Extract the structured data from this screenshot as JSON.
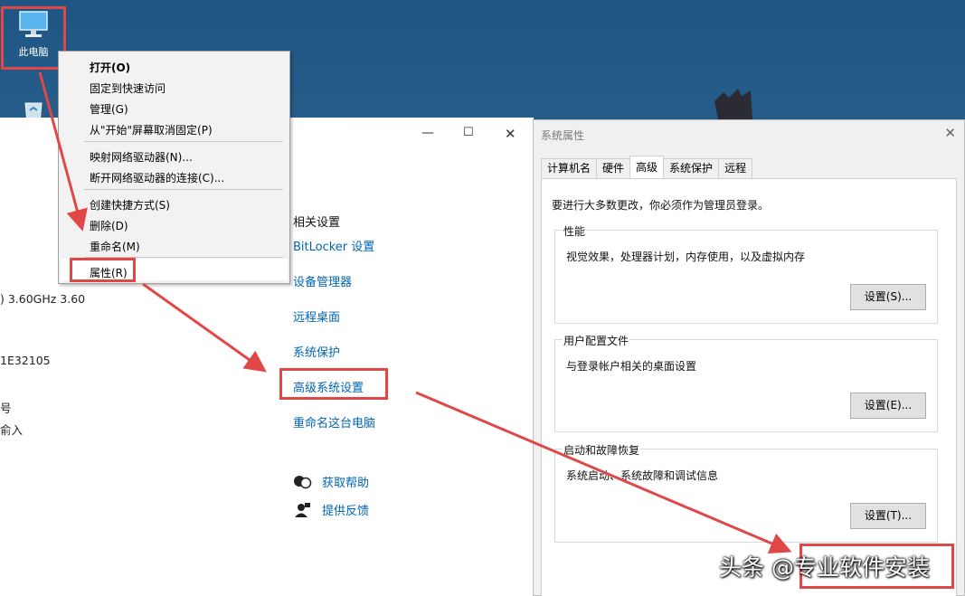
{
  "desktop": {
    "pc_icon_label": "此电脑",
    "icon_names": [
      "monitor-icon",
      "recycle-bin-icon"
    ]
  },
  "context_menu": {
    "items": [
      {
        "label": "打开(O)",
        "bold": true
      },
      {
        "label": "固定到快速访问"
      },
      {
        "label": "管理(G)"
      },
      {
        "label": "从\"开始\"屏幕取消固定(P)"
      },
      {
        "label": "映射网络驱动器(N)..."
      },
      {
        "label": "断开网络驱动器的连接(C)..."
      },
      {
        "label": "创建快捷方式(S)"
      },
      {
        "label": "删除(D)"
      },
      {
        "label": "重命名(M)"
      },
      {
        "label": "属性(R)"
      }
    ]
  },
  "system_window": {
    "controls": {
      "minimize": "—",
      "maximize": "☐",
      "close": "✕"
    },
    "left_fragments": [
      ") 3.60GHz   3.60",
      "1E32105",
      "号",
      "俞入"
    ],
    "related_title": "相关设置",
    "links": [
      "BitLocker 设置",
      "设备管理器",
      "远程桌面",
      "系统保护",
      "高级系统设置",
      "重命名这台电脑"
    ],
    "help": {
      "get_help": "获取帮助",
      "feedback": "提供反馈"
    }
  },
  "properties_dialog": {
    "title": "系统属性",
    "close": "✕",
    "tabs": [
      "计算机名",
      "硬件",
      "高级",
      "系统保护",
      "远程"
    ],
    "active_tab": "高级",
    "admin_note": "要进行大多数更改，你必须作为管理员登录。",
    "groups": [
      {
        "title": "性能",
        "desc": "视觉效果，处理器计划，内存使用，以及虚拟内存",
        "button": "设置(S)..."
      },
      {
        "title": "用户配置文件",
        "desc": "与登录帐户相关的桌面设置",
        "button": "设置(E)..."
      },
      {
        "title": "启动和故障恢复",
        "desc": "系统启动、系统故障和调试信息",
        "button": "设置(T)..."
      }
    ]
  },
  "watermark": "头条 @专业软件安装",
  "colors": {
    "highlight_red": "#e04848",
    "link_blue": "#0064b4",
    "desktop_blue": "#2d6590"
  }
}
